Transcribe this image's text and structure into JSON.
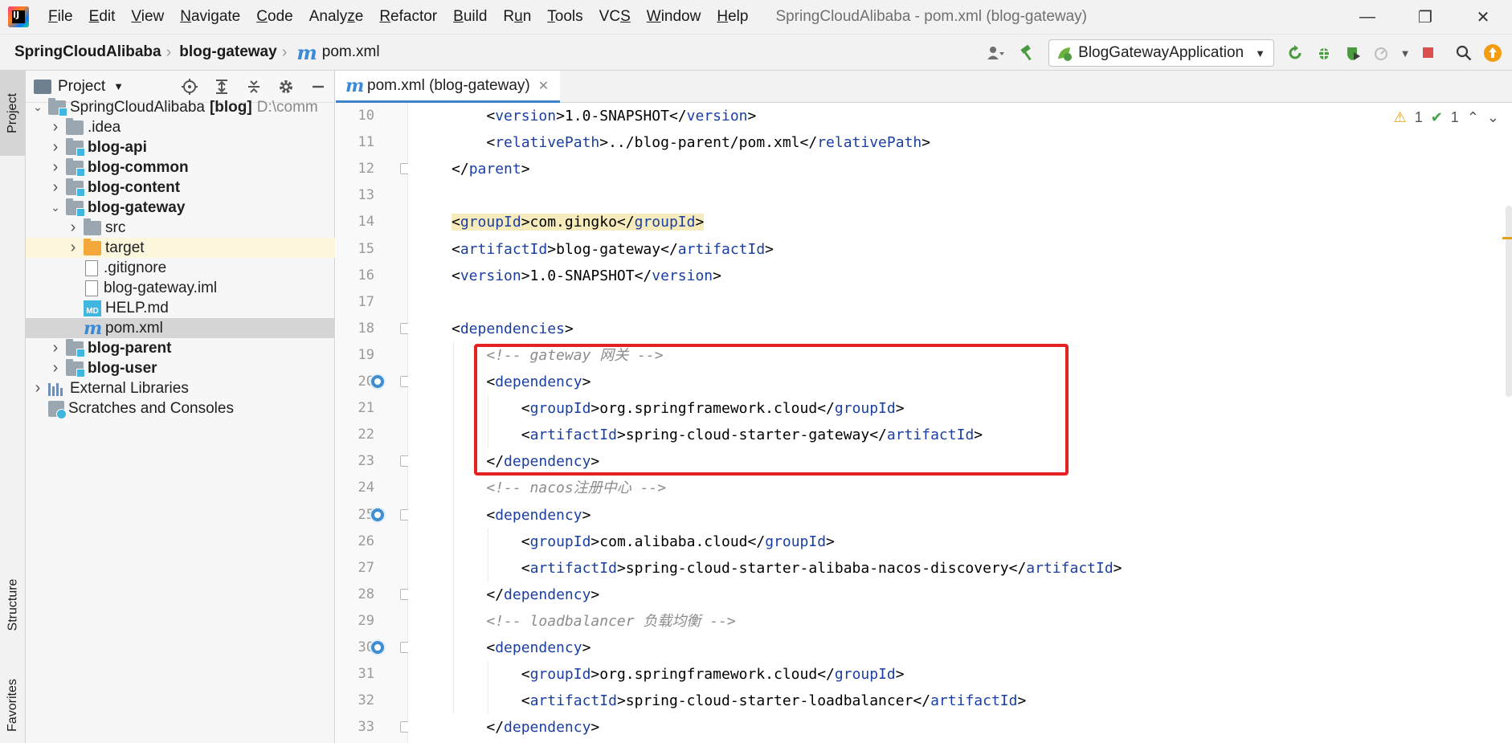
{
  "menubar": {
    "items": [
      "File",
      "Edit",
      "View",
      "Navigate",
      "Code",
      "Analyze",
      "Refactor",
      "Build",
      "Run",
      "Tools",
      "VCS",
      "Window",
      "Help"
    ],
    "underline": [
      "F",
      "E",
      "V",
      "N",
      "C",
      "z",
      "R",
      "B",
      "u",
      "T",
      "S",
      "W",
      "H"
    ],
    "title": "SpringCloudAlibaba - pom.xml (blog-gateway)"
  },
  "window_controls": {
    "minimize": "—",
    "restore": "❐",
    "close": "✕"
  },
  "navbar": {
    "crumbs": [
      "SpringCloudAlibaba",
      "blog-gateway",
      "pom.xml"
    ],
    "run_config": "BlogGatewayApplication"
  },
  "left_strip": {
    "project_tab": "Project",
    "structure_tab": "Structure",
    "favorites_tab": "Favorites"
  },
  "project_panel": {
    "title": "Project",
    "tree": [
      {
        "label": "SpringCloudAlibaba",
        "suffix": "[blog]",
        "path": "D:\\comm"
      },
      {
        "label": ".idea"
      },
      {
        "label": "blog-api"
      },
      {
        "label": "blog-common"
      },
      {
        "label": "blog-content"
      },
      {
        "label": "blog-gateway"
      },
      {
        "label": "src"
      },
      {
        "label": "target"
      },
      {
        "label": ".gitignore"
      },
      {
        "label": "blog-gateway.iml"
      },
      {
        "label": "HELP.md"
      },
      {
        "label": "pom.xml"
      },
      {
        "label": "blog-parent"
      },
      {
        "label": "blog-user"
      },
      {
        "label": "External Libraries"
      },
      {
        "label": "Scratches and Consoles"
      }
    ]
  },
  "editor": {
    "tab_label": "pom.xml (blog-gateway)",
    "warnings": "1",
    "weak_warnings": "1",
    "line_numbers": [
      "10",
      "11",
      "12",
      "13",
      "14",
      "15",
      "16",
      "17",
      "18",
      "19",
      "20",
      "21",
      "22",
      "23",
      "24",
      "25",
      "26",
      "27",
      "28",
      "29",
      "30",
      "31",
      "32",
      "33"
    ],
    "lines": [
      {
        "indent": 2,
        "tag": "version",
        "text": "1.0-SNAPSHOT"
      },
      {
        "indent": 2,
        "tag": "relativePath",
        "text": "../blog-parent/pom.xml"
      },
      {
        "indent": 1,
        "close": "parent"
      },
      {
        "blank": true
      },
      {
        "indent": 1,
        "tag": "groupId",
        "text": "com.gingko",
        "highlight": true
      },
      {
        "indent": 1,
        "tag": "artifactId",
        "text": "blog-gateway"
      },
      {
        "indent": 1,
        "tag": "version",
        "text": "1.0-SNAPSHOT"
      },
      {
        "blank": true
      },
      {
        "indent": 1,
        "open": "dependencies"
      },
      {
        "indent": 2,
        "comment": "<!-- gateway 网关 -->"
      },
      {
        "indent": 2,
        "open": "dependency"
      },
      {
        "indent": 3,
        "tag": "groupId",
        "text": "org.springframework.cloud"
      },
      {
        "indent": 3,
        "tag": "artifactId",
        "text": "spring-cloud-starter-gateway"
      },
      {
        "indent": 2,
        "close": "dependency"
      },
      {
        "indent": 2,
        "comment": "<!-- nacos注册中心 -->"
      },
      {
        "indent": 2,
        "open": "dependency"
      },
      {
        "indent": 3,
        "tag": "groupId",
        "text": "com.alibaba.cloud"
      },
      {
        "indent": 3,
        "tag": "artifactId",
        "text": "spring-cloud-starter-alibaba-nacos-discovery"
      },
      {
        "indent": 2,
        "close": "dependency"
      },
      {
        "indent": 2,
        "comment": "<!-- loadbalancer 负载均衡 -->"
      },
      {
        "indent": 2,
        "open": "dependency"
      },
      {
        "indent": 3,
        "tag": "groupId",
        "text": "org.springframework.cloud"
      },
      {
        "indent": 3,
        "tag": "artifactId",
        "text": "spring-cloud-starter-loadbalancer"
      },
      {
        "indent": 2,
        "close": "dependency"
      }
    ]
  },
  "colors": {
    "accent": "#4083c9",
    "tag": "#1b3fa1",
    "comment": "#8c8c8c",
    "annotation_box": "#e52222",
    "line_highlight": "#f6ebbc"
  }
}
